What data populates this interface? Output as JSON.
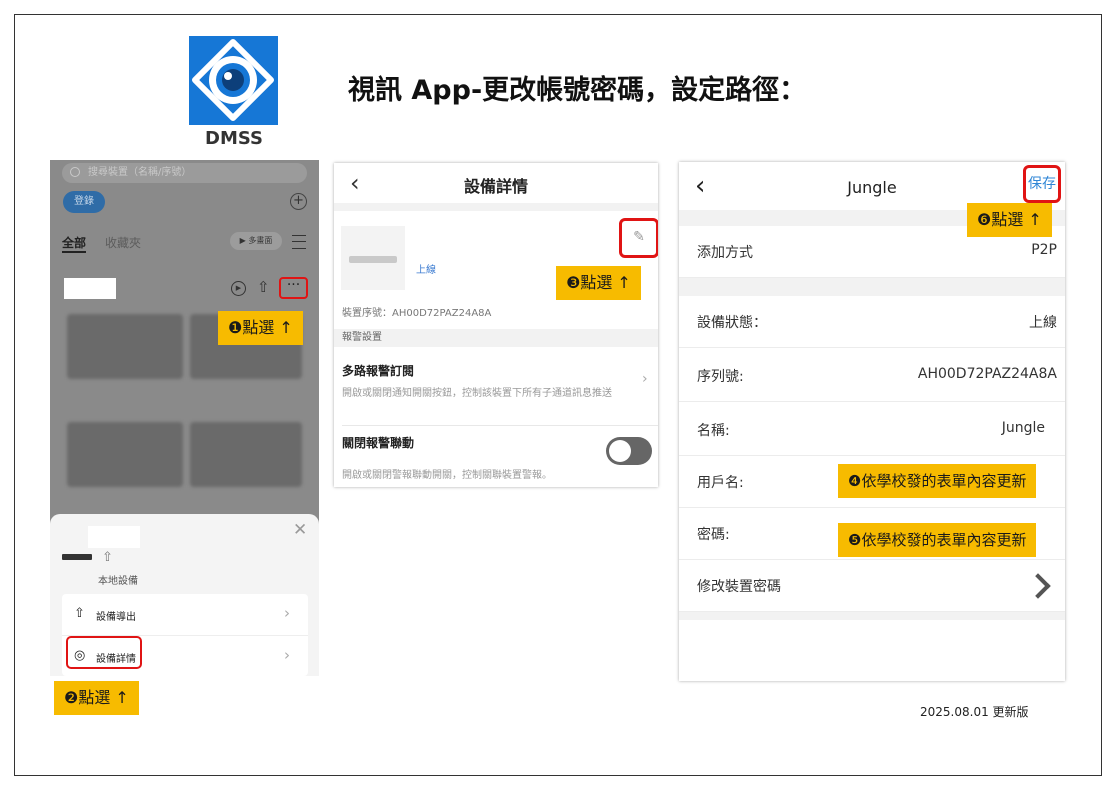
{
  "page": {
    "title": "視訊 App-更改帳號密碼，設定路徑：",
    "logo_label": "DMSS",
    "footer": "2025.08.01 更新版"
  },
  "colors": {
    "callout": "#f7bb00",
    "highlight_border": "#e01414",
    "logo_bg": "#1677d6",
    "save_text": "#2f86d6"
  },
  "panel1": {
    "search_placeholder": "搜尋裝置（名稱/序號）",
    "login_label": "登錄",
    "add_icon": "plus-circle-icon",
    "tab_all": "全部",
    "tab_favorites": "收藏夾",
    "multi_screen": "▶ 多畫面",
    "more_label": "···",
    "sheet": {
      "local_device": "本地設備",
      "items": [
        {
          "label": "設備導出",
          "icon": "upload-icon"
        },
        {
          "label": "設備詳情",
          "icon": "camera-icon"
        }
      ]
    }
  },
  "panel2": {
    "title": "設備詳情",
    "status": "上線",
    "serial": "裝置序號：AH00D72PAZ24A8A",
    "section_alarm": "報警設置",
    "item1_title": "多路報警訂閱",
    "item1_desc": "開啟或關閉通知開關按鈕，控制該裝置下所有子通道訊息推送",
    "item2_title": "關閉報警聯動",
    "item2_desc": "開啟或關閉警報聯動開關，控制關聯裝置警報。",
    "toggle_on": false
  },
  "panel3": {
    "title": "Jungle",
    "save_label": "保存",
    "rows": [
      {
        "key": "添加方式",
        "value": "P2P"
      },
      {
        "key": "設備狀態：",
        "value": "上線"
      },
      {
        "key": "序列號:",
        "value": "AH00D72PAZ24A8A"
      },
      {
        "key": "名稱:",
        "value": "Jungle"
      },
      {
        "key": "用戶名:",
        "value": ""
      },
      {
        "key": "密碼:",
        "value": ""
      },
      {
        "key": "修改裝置密碼",
        "value": ""
      }
    ]
  },
  "callouts": {
    "step1": "❶點選 ↑",
    "step2": "❷點選 ↑",
    "step3": "❸點選 ↑",
    "step4": "❹依學校發的表單內容更新",
    "step5": "❺依學校發的表單內容更新",
    "step6": "❻點選 ↑"
  }
}
